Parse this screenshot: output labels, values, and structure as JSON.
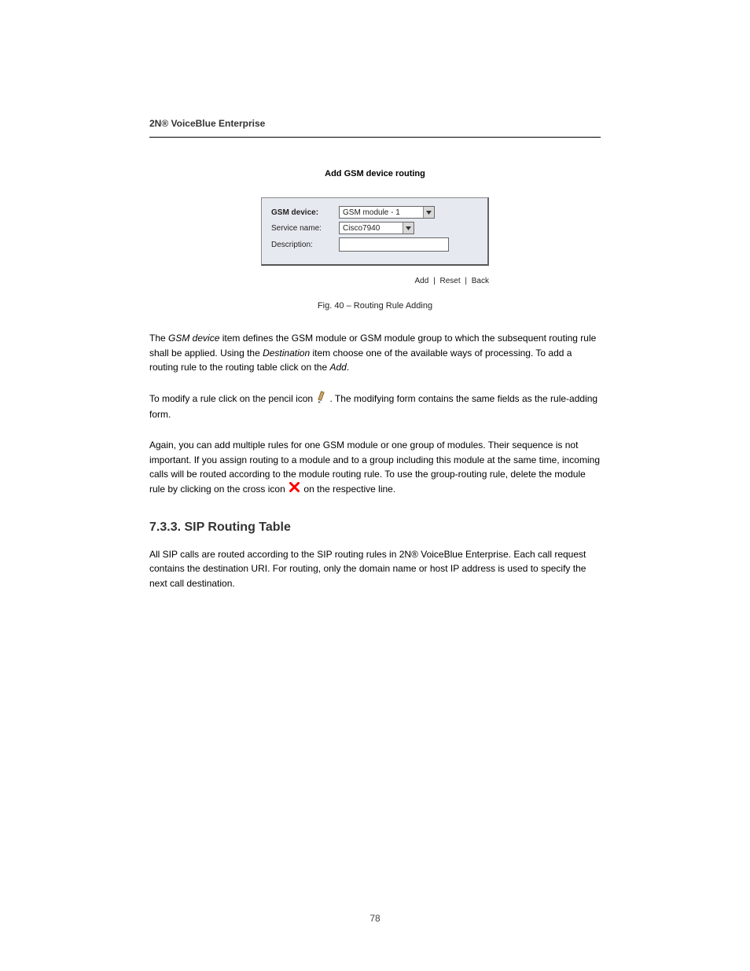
{
  "header": {
    "pageTitle": "2N® VoiceBlue Enterprise"
  },
  "figure": {
    "title": "Add GSM device routing",
    "rows": {
      "gsmDevice": {
        "label": "GSM device:",
        "value": "GSM module - 1"
      },
      "serviceName": {
        "label": "Service name:",
        "value": "Cisco7940"
      },
      "description": {
        "label": "Description:",
        "value": ""
      }
    },
    "actions": {
      "add": "Add",
      "reset": "Reset",
      "back": "Back"
    },
    "caption": "Fig. 40 – Routing Rule Adding"
  },
  "para1_a": "The ",
  "para1_b": "GSM device",
  "para1_c": " item defines the GSM module or GSM module group to which the subsequent routing rule shall be applied. Using the ",
  "para1_d": "Destination",
  "para1_e": " item choose one of the available ways of processing. To add a routing rule to the routing table click on the ",
  "para1_f": "Add",
  "para1_g": ".",
  "para2": "To modify a rule click on the pencil icon",
  "para2_tail": ". The modifying form contains the same fields as the rule-adding form.",
  "para3_a": "Again, you can add multiple rules for one GSM module or one group of modules. Their sequence is not important. If you assign routing to a module and to a group including this module at the same time, incoming calls will be routed according to the module routing rule. To use the group-routing rule, delete the module rule by clicking on the cross icon",
  "para3_b": " on the respective line.",
  "heading2": "7.3.3. SIP Routing Table",
  "para4": "All SIP calls are routed according to the SIP routing rules in 2N® VoiceBlue Enterprise. Each call request contains the destination URI. For routing, only the domain name or host IP address is used to specify the next call destination.",
  "footer": {
    "page": "78"
  }
}
